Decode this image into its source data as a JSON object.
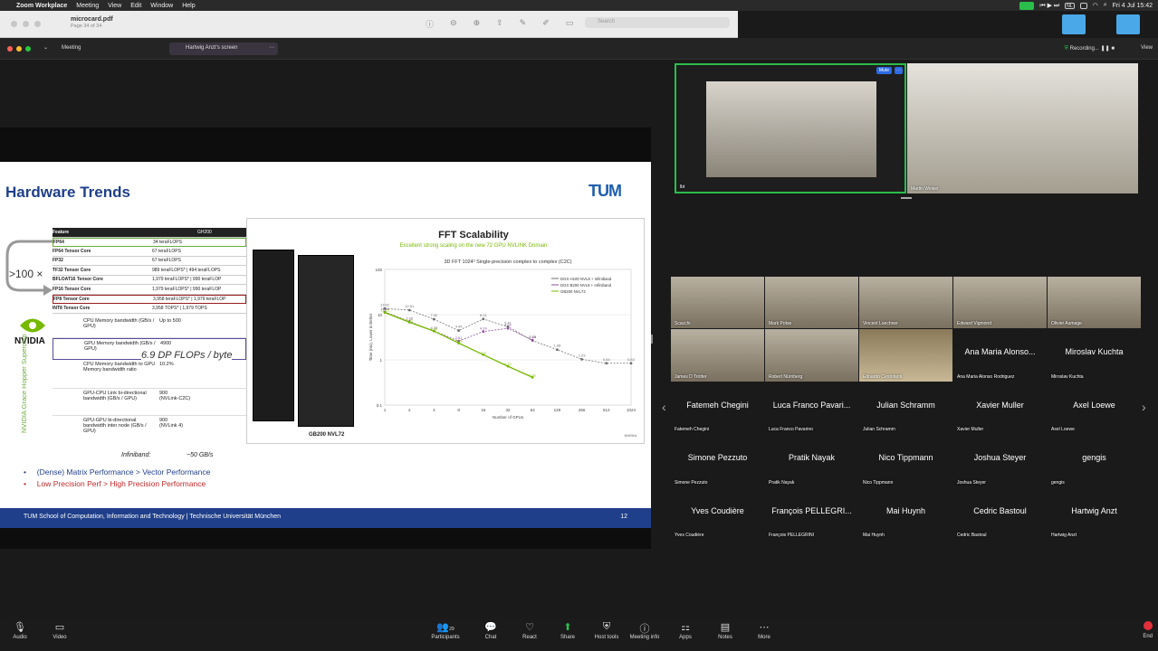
{
  "menubar": {
    "app": "Zoom Workplace",
    "items": [
      "Meeting",
      "View",
      "Edit",
      "Window",
      "Help"
    ],
    "clock": "Fri 4 Jul  15:42",
    "lang": "NL"
  },
  "pdf": {
    "filename": "microcard.pdf",
    "page_info": "Page 34 of 34",
    "search_placeholder": "Search"
  },
  "zoom_header": {
    "meeting_label": "Meeting",
    "share_label": "Hartwig Anzt's screen",
    "recording": "Recording...",
    "view": "View"
  },
  "slide": {
    "title": "Hardware Trends",
    "logo": "TUM",
    "spec_header": [
      "Feature",
      "GH200"
    ],
    "spec_rows": [
      [
        "FP64",
        "34 teraFLOPS"
      ],
      [
        "FP64 Tensor Core",
        "67 teraFLOPS"
      ],
      [
        "FP32",
        "67 teraFLOPS"
      ],
      [
        "TF32 Tensor Core",
        "989 teraFLOPS* | 494 teraFLOPS"
      ],
      [
        "BFLOAT16 Tensor Core",
        "1,979 teraFLOPS* | 990 teraFLOP"
      ],
      [
        "FP16 Tensor Core",
        "1,979 teraFLOPS* | 990 teraFLOP"
      ],
      [
        "FP8 Tensor Core",
        "3,958 teraFLOPS* | 1,979 teraFLOP"
      ],
      [
        "INT8 Tensor Core",
        "3,958 TOPS* | 1,979 TOPS"
      ]
    ],
    "mem_rows": [
      [
        "CPU Memory bandwidth (GB/s / GPU)",
        "Up to 500"
      ],
      [
        "GPU Memory bandwidth (GB/s / GPU)",
        "4900"
      ],
      [
        "CPU Memory bandwidth to GPU Memory bandwidth ratio",
        "10.2%"
      ],
      [
        "GPU-CPU Link bi-directional bandwidth (GB/s / GPU)",
        "900\n(NVLink-C2C)"
      ],
      [
        "GPU-GPU bi-directional bandwidth inter node (GB/s / GPU)",
        "900\n(NVLink 4)"
      ]
    ],
    "multiplier": ">100 ×",
    "nvidia": "NVIDIA",
    "vertical_label": "NVIDIA Grace Hopper Superchip",
    "dp_annotation": "6.9 DP FLOPs / byte",
    "infiniband_label": "Infiniband:",
    "infiniband_value": "~50 GB/s",
    "bullets": [
      "(Dense) Matrix Performance  > Vector Performance",
      "Low Precision  Perf > High Precision Performance"
    ],
    "footer": "TUM School of Computation, Information and Technology | Technische Universität München",
    "page_number": "12"
  },
  "fft": {
    "title": "FFT Scalability",
    "subtitle": "Excellent strong scaling on the new 72 GPU NVLINK Domain",
    "rack_label": "GB200 NVL72",
    "nvidia_mark": "NVIDIA",
    "chart_data": {
      "type": "line",
      "title": "3D FFT 1024³ Single-precision complex to complex (C2C)",
      "xlabel": "Number of GPUs",
      "ylabel": "Time (ms), Lower is Better",
      "x": [
        1,
        2,
        4,
        8,
        16,
        32,
        64,
        128,
        256,
        512,
        1024
      ],
      "yscale": "log",
      "ylim": [
        0.1,
        100
      ],
      "ticks_y": [
        "100",
        "10",
        "1",
        "0.1"
      ],
      "legend": "top-right",
      "series": [
        {
          "name": "DGX H100 NVL8 + Infiniband",
          "color": "#6e6e6e",
          "values": [
            13.62,
            12.61,
            7.92,
            4.45,
            8.01,
            5.41,
            2.66,
            1.68,
            1.03,
            0.84,
            0.84
          ]
        },
        {
          "name": "DGX B200 NVL8 + Infiniband",
          "color": "#8e4f9e",
          "values": [
            11.51,
            7.06,
            4.33,
            2.61,
            4.24,
            4.97,
            2.74,
            null,
            null,
            null,
            null
          ]
        },
        {
          "name": "GB200 NVL72",
          "color": "#76b900",
          "values": [
            11.15,
            6.81,
            4.32,
            2.35,
            1.3,
            0.72,
            0.41,
            null,
            null,
            null,
            null
          ]
        }
      ]
    }
  },
  "spotlight": [
    {
      "name": "lbt",
      "label": "Mute",
      "more": "···"
    },
    {
      "name": "Martin Weiser"
    }
  ],
  "gallery": [
    {
      "name": "Scacchi",
      "type": "video"
    },
    {
      "name": "Mark Potse",
      "type": "video"
    },
    {
      "name": "Vincent Loechner",
      "type": "video"
    },
    {
      "name": "Edward Vigmond",
      "type": "video"
    },
    {
      "name": "Olivier Aumage",
      "type": "video"
    },
    {
      "name": "James D Trotter",
      "type": "video"
    },
    {
      "name": "Robert Nürnberg",
      "type": "video"
    },
    {
      "name": "Edoardo Centofanti",
      "type": "photo"
    },
    {
      "name": "Ana Maria Alonso Rodriguez",
      "display": "Ana Maria Alonso...",
      "type": "name"
    },
    {
      "name": "Miroslav Kuchta",
      "display": "Miroslav Kuchta",
      "type": "name"
    },
    {
      "name": "Fatemeh Chegini",
      "display": "Fatemeh Chegini",
      "type": "name"
    },
    {
      "name": "Luca Franco Pavarino",
      "display": "Luca Franco Pavari...",
      "type": "name"
    },
    {
      "name": "Julian Schramm",
      "display": "Julian Schramm",
      "type": "name"
    },
    {
      "name": "Xavier Muller",
      "display": "Xavier Muller",
      "type": "name"
    },
    {
      "name": "Axel Loewe",
      "display": "Axel Loewe",
      "type": "name"
    },
    {
      "name": "Simone Pezzuto",
      "display": "Simone Pezzuto",
      "type": "name"
    },
    {
      "name": "Pratik Nayak",
      "display": "Pratik Nayak",
      "type": "name"
    },
    {
      "name": "Nico Tippmann",
      "display": "Nico Tippmann",
      "type": "name"
    },
    {
      "name": "Joshua Steyer",
      "display": "Joshua Steyer",
      "type": "name"
    },
    {
      "name": "gengis",
      "display": "gengis",
      "type": "name"
    },
    {
      "name": "Yves Coudière",
      "display": "Yves Coudière",
      "type": "name"
    },
    {
      "name": "François PELLEGRINI",
      "display": "François PELLEGRI...",
      "type": "name"
    },
    {
      "name": "Mai Huynh",
      "display": "Mai Huynh",
      "type": "name"
    },
    {
      "name": "Cedric Bastoul",
      "display": "Cedric Bastoul",
      "type": "name"
    },
    {
      "name": "Hartwig Anzt",
      "display": "Hartwig Anzt",
      "type": "name"
    }
  ],
  "toolbar": {
    "audio": "Audio",
    "video": "Video",
    "participants": "Participants",
    "participants_count": "29",
    "chat": "Chat",
    "react": "React",
    "share": "Share",
    "host_tools": "Host tools",
    "meeting_info": "Meeting info",
    "apps": "Apps",
    "notes": "Notes",
    "more": "More",
    "end": "End"
  }
}
